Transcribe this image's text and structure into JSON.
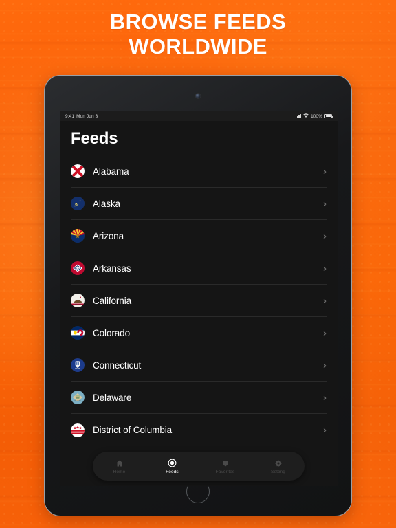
{
  "headline": {
    "line1": "BROWSE FEEDS",
    "line2": "WORLDWIDE"
  },
  "theme": {
    "background_orange": "#F4600A",
    "headline_color": "#FFFFFF",
    "screen_background": "#151515",
    "divider_color": "#2A2A2A",
    "active_tab_color": "#FFFFFF",
    "inactive_tab_color": "#4A4A4A"
  },
  "device": {
    "status_bar": {
      "time": "9:41",
      "date": "Mon Jun 3",
      "battery_percent": "100%",
      "signal_icon": "cellular-signal-icon",
      "wifi_icon": "wifi-icon",
      "battery_icon": "battery-full-icon"
    },
    "camera_icon": "front-camera-icon",
    "home_button_icon": "home-button-icon"
  },
  "screen": {
    "title": "Feeds",
    "chevron_glyph": "›",
    "items": [
      {
        "label": "Alabama",
        "flag": "flag-alabama"
      },
      {
        "label": "Alaska",
        "flag": "flag-alaska"
      },
      {
        "label": "Arizona",
        "flag": "flag-arizona"
      },
      {
        "label": "Arkansas",
        "flag": "flag-arkansas"
      },
      {
        "label": "California",
        "flag": "flag-california"
      },
      {
        "label": "Colorado",
        "flag": "flag-colorado"
      },
      {
        "label": "Connecticut",
        "flag": "flag-connecticut"
      },
      {
        "label": "Delaware",
        "flag": "flag-delaware"
      },
      {
        "label": "District of Columbia",
        "flag": "flag-district-of-columbia"
      }
    ]
  },
  "tabbar": {
    "tabs": [
      {
        "label": "Home",
        "icon": "home-icon",
        "active": false
      },
      {
        "label": "Feeds",
        "icon": "feeds-icon",
        "active": true
      },
      {
        "label": "Favorites",
        "icon": "heart-icon",
        "active": false
      },
      {
        "label": "Setting",
        "icon": "gear-icon",
        "active": false
      }
    ]
  }
}
